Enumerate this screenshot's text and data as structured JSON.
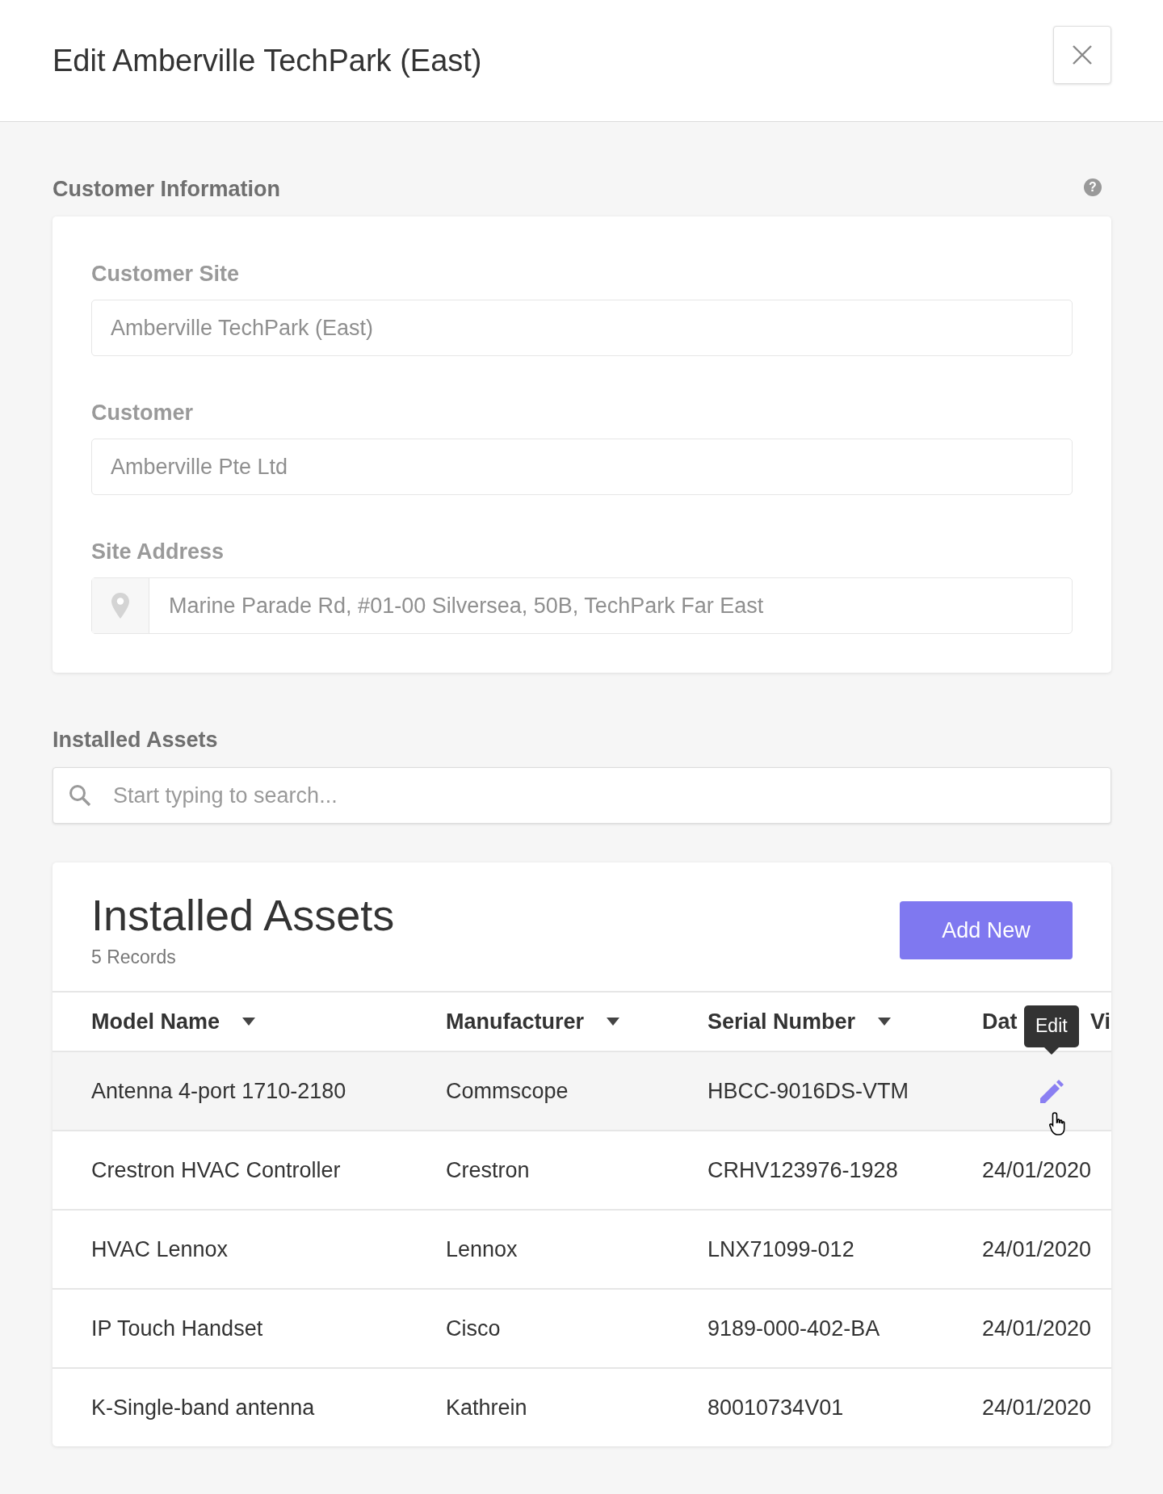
{
  "dialog": {
    "title": "Edit Amberville TechPark (East)"
  },
  "customer_information": {
    "heading": "Customer Information",
    "help_icon": "?",
    "fields": [
      {
        "kind": "text",
        "label": "Customer Site",
        "value": "Amberville TechPark (East)"
      },
      {
        "kind": "text",
        "label": "Customer",
        "value": "Amberville Pte Ltd"
      },
      {
        "kind": "address",
        "label": "Site Address",
        "value": "Marine Parade Rd, #01-00 Silversea, 50B, TechPark Far East"
      }
    ]
  },
  "installed_assets": {
    "heading": "Installed Assets",
    "search": {
      "placeholder": "Start typing to search..."
    },
    "table": {
      "title": "Installed Assets",
      "count": "5 Records",
      "add_button": "Add New",
      "columns": [
        {
          "label": "Model Name",
          "sortable": true
        },
        {
          "label": "Manufacturer",
          "sortable": true
        },
        {
          "label": "Serial Number",
          "sortable": true
        },
        {
          "label": "Dat"
        },
        {
          "label": "Vi"
        }
      ],
      "rows": [
        {
          "hovered": true,
          "tooltip": "Edit",
          "cells": [
            "Antenna 4-port 1710-2180",
            "Commscope",
            "HBCC-9016DS-VTM"
          ]
        },
        {
          "hovered": false,
          "cells": [
            "Crestron HVAC Controller",
            "Crestron",
            "CRHV123976-1928",
            "24/01/2020"
          ]
        },
        {
          "hovered": false,
          "cells": [
            "HVAC Lennox",
            "Lennox",
            "LNX71099-012",
            "24/01/2020"
          ]
        },
        {
          "hovered": false,
          "cells": [
            "IP Touch Handset",
            "Cisco",
            "9189-000-402-BA",
            "24/01/2020"
          ]
        },
        {
          "hovered": false,
          "cells": [
            "K-Single-band antenna",
            "Kathrein",
            "80010734V01",
            "24/01/2020"
          ]
        }
      ]
    }
  }
}
